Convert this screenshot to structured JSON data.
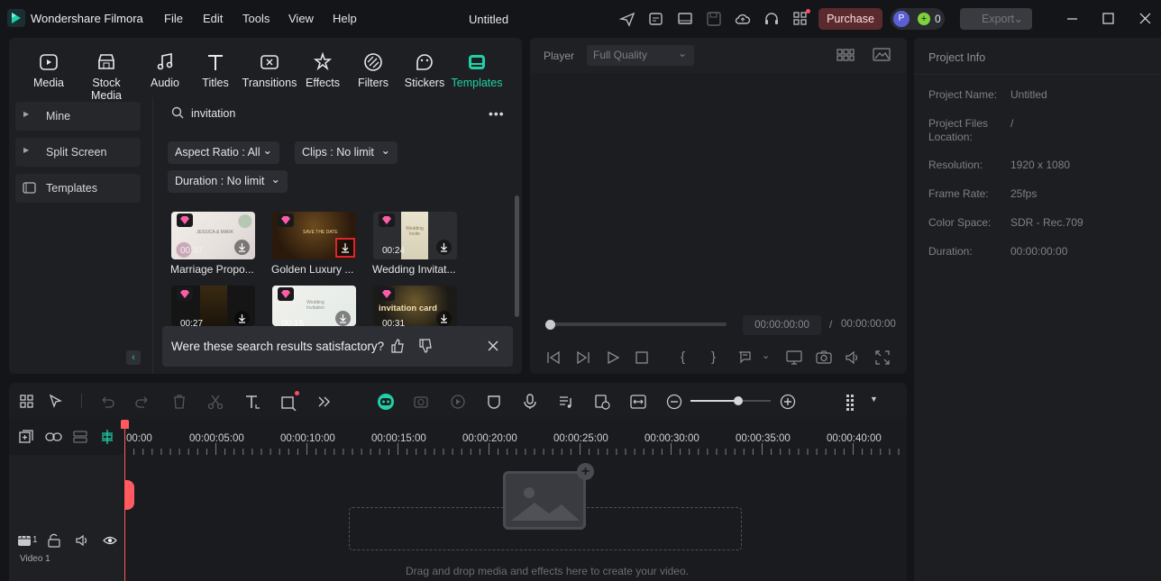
{
  "app": {
    "name": "Wondershare Filmora",
    "project_title": "Untitled"
  },
  "menu": [
    "File",
    "Edit",
    "Tools",
    "View",
    "Help"
  ],
  "header": {
    "purchase_label": "Purchase",
    "avatar_letter": "P",
    "credits": "0",
    "export_label": "Export",
    "accent": "#1fd1a7",
    "purchase_color": "#5b2a2e"
  },
  "media_tabs": [
    {
      "label": "Media",
      "icon": "media-icon"
    },
    {
      "label": "Stock Media",
      "icon": "stock-media-icon"
    },
    {
      "label": "Audio",
      "icon": "music-note-icon"
    },
    {
      "label": "Titles",
      "icon": "text-icon"
    },
    {
      "label": "Transitions",
      "icon": "transition-icon"
    },
    {
      "label": "Effects",
      "icon": "effects-icon"
    },
    {
      "label": "Filters",
      "icon": "filters-icon"
    },
    {
      "label": "Stickers",
      "icon": "sticker-icon"
    },
    {
      "label": "Templates",
      "icon": "templates-icon",
      "active": true
    }
  ],
  "sidebar": {
    "items": [
      {
        "label": "Mine"
      },
      {
        "label": "Split Screen"
      },
      {
        "label": "Templates"
      }
    ]
  },
  "search": {
    "value": "invitation"
  },
  "filters": {
    "aspect_ratio": "Aspect Ratio : All",
    "clips": "Clips : No limit",
    "duration": "Duration : No limit"
  },
  "templates": [
    {
      "title": "Marriage Propo...",
      "duration": "00:37",
      "thumb_text": "JESSICA & MARK"
    },
    {
      "title": "Golden Luxury ...",
      "duration": "",
      "thumb_text": "SAVE THE DATE"
    },
    {
      "title": "Wedding Invitat...",
      "duration": "00:24",
      "thumb_text": "Wedding Invite"
    },
    {
      "title": "",
      "duration": "00:27",
      "thumb_text": ""
    },
    {
      "title": "",
      "duration": "00:15",
      "thumb_text": "Wedding Invitation"
    },
    {
      "title": "",
      "duration": "00:31",
      "thumb_text": "invitation card"
    }
  ],
  "feedback": {
    "question": "Were these search results satisfactory?"
  },
  "player": {
    "label": "Player",
    "quality": "Full Quality",
    "current_time": "00:00:00:00",
    "separator": "/",
    "total_time": "00:00:00:00",
    "progress": 0
  },
  "project_info": {
    "title": "Project Info",
    "rows": [
      {
        "label": "Project Name:",
        "value": "Untitled"
      },
      {
        "label": "Project Files Location:",
        "value": "/"
      },
      {
        "label": "Resolution:",
        "value": "1920 x 1080"
      },
      {
        "label": "Frame Rate:",
        "value": "25fps"
      },
      {
        "label": "Color Space:",
        "value": "SDR - Rec.709"
      },
      {
        "label": "Duration:",
        "value": "00:00:00:00"
      }
    ]
  },
  "timeline": {
    "ruler": [
      "00:00",
      "00:00:05:00",
      "00:00:10:00",
      "00:00:15:00",
      "00:00:20:00",
      "00:00:25:00",
      "00:00:30:00",
      "00:00:35:00",
      "00:00:40:00"
    ],
    "track_label": "Video 1",
    "track_count": "1",
    "drop_hint": "Drag and drop media and effects here to create your video.",
    "zoom_level": 0.6
  }
}
